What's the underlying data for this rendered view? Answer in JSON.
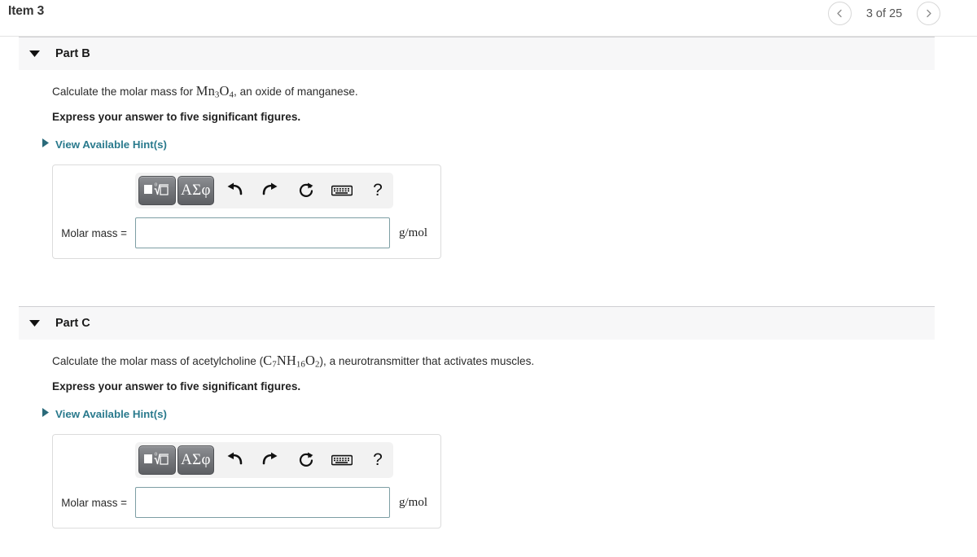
{
  "header": {
    "item_title": "Item 3",
    "pager": {
      "prev_icon": "chevron-left-icon",
      "next_icon": "chevron-right-icon",
      "count_text": "3 of 25"
    }
  },
  "accent_colors": {
    "hint_link": "#2a7a8d",
    "input_border": "#7d9ea4",
    "part_header_bg": "#f7f7f8",
    "mathbar_bg": "#f2f2f2",
    "math_button": "#76787c"
  },
  "toolbar": {
    "template_button_label": "math-template",
    "greek_button_label": "ΑΣφ",
    "undo_label": "undo",
    "redo_label": "redo",
    "reset_label": "reset",
    "keyboard_label": "keyboard",
    "help_label": "?"
  },
  "parts": [
    {
      "name": "Part B",
      "caret": "caret-down-icon",
      "prompt_pre": "Calculate the molar mass for ",
      "formula_parts": [
        {
          "text": "Mn",
          "sub": "3"
        },
        {
          "text": "O",
          "sub": "4"
        }
      ],
      "prompt_post": ", an oxide of manganese.",
      "express": "Express your answer to five significant figures.",
      "hints_label": "View Available Hint(s)",
      "answer_label": "Molar mass =",
      "answer_value": "",
      "answer_placeholder": "",
      "answer_units": "g/mol"
    },
    {
      "name": "Part C",
      "caret": "caret-down-icon",
      "prompt_pre": "Calculate the molar mass of acetylcholine (",
      "formula_parts": [
        {
          "text": "C",
          "sub": "7"
        },
        {
          "text": "NH",
          "sub": "16"
        },
        {
          "text": "O",
          "sub": "2"
        }
      ],
      "prompt_post": "), a neurotransmitter that activates muscles.",
      "express": "Express your answer to five significant figures.",
      "hints_label": "View Available Hint(s)",
      "answer_label": "Molar mass =",
      "answer_value": "",
      "answer_placeholder": "",
      "answer_units": "g/mol"
    }
  ]
}
